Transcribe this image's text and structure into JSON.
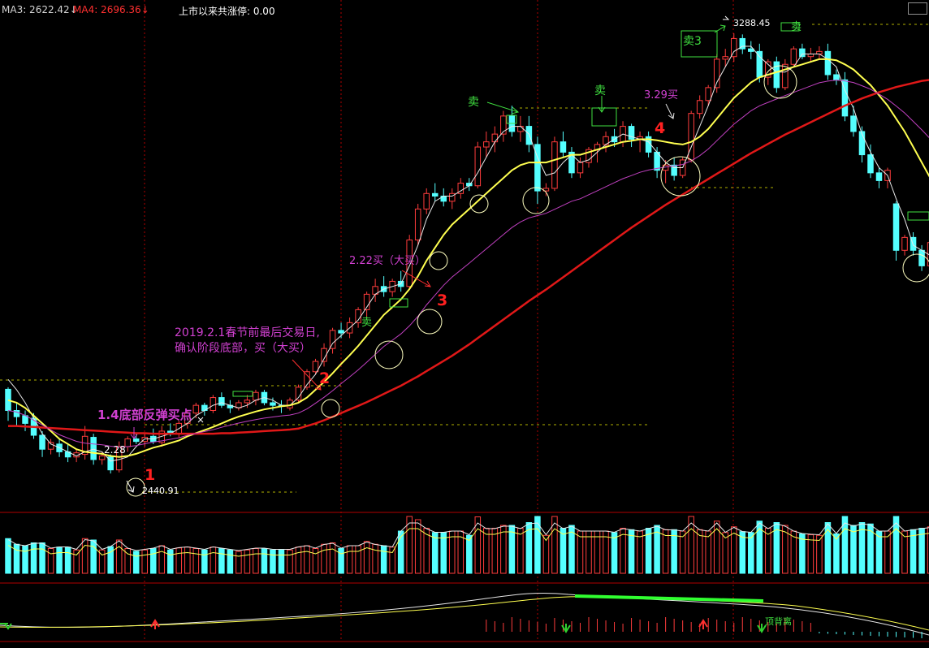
{
  "header": {
    "ma3": {
      "label": "MA3: 2622.42",
      "arrow": "↓",
      "color": "#d4d4d4"
    },
    "ma4": {
      "label": "MA4: 2696.36",
      "arrow": "↓",
      "color": "#ff3030"
    },
    "limit_text": "上市以来共涨停: 0.00"
  },
  "annotations": {
    "bottom_rebound": "1.4底部反弹买点",
    "low_price": "2440.91",
    "price_228": "2.28",
    "spring_line1": "2019.2.1春节前最后交易日,",
    "spring_line2": "确认阶段底部，买（大买）",
    "buy_222": "2.22买（大买）",
    "buy_329": "3.29买",
    "high_price": "3288.45",
    "sell1": "卖",
    "sell2": "卖",
    "sell3": "卖3",
    "sell_small1": "卖",
    "sell_small2": "卖",
    "top_divergence": "顶背离",
    "num1": "1",
    "num2": "2",
    "num3": "3",
    "num4": "4"
  },
  "colors": {
    "up": "#ff3c3c",
    "down": "#54ffff",
    "ma_white": "#e8e8e8",
    "ma_yellow": "#ffff50",
    "ma_magenta": "#c040c0",
    "ma_red": "#e01818",
    "annotation_magenta": "#d040d0",
    "annotation_green": "#40e040",
    "grid": "#b00000"
  },
  "chart_data": {
    "type": "candlestick",
    "price_range": [
      2380,
      3320
    ],
    "candles": [
      [
        2601,
        2605,
        2540,
        2560
      ],
      [
        2560,
        2575,
        2530,
        2548
      ],
      [
        2550,
        2560,
        2520,
        2535
      ],
      [
        2545,
        2555,
        2505,
        2512
      ],
      [
        2512,
        2520,
        2470,
        2485
      ],
      [
        2485,
        2505,
        2475,
        2498
      ],
      [
        2495,
        2505,
        2470,
        2480
      ],
      [
        2480,
        2495,
        2460,
        2470
      ],
      [
        2470,
        2485,
        2460,
        2478
      ],
      [
        2475,
        2530,
        2465,
        2510
      ],
      [
        2508,
        2515,
        2455,
        2465
      ],
      [
        2465,
        2480,
        2455,
        2472
      ],
      [
        2470,
        2475,
        2438,
        2445
      ],
      [
        2445,
        2500,
        2440,
        2490
      ],
      [
        2490,
        2510,
        2480,
        2505
      ],
      [
        2505,
        2515,
        2495,
        2500
      ],
      [
        2500,
        2515,
        2490,
        2508
      ],
      [
        2510,
        2525,
        2495,
        2500
      ],
      [
        2498,
        2530,
        2490,
        2520
      ],
      [
        2520,
        2535,
        2510,
        2515
      ],
      [
        2515,
        2540,
        2508,
        2535
      ],
      [
        2535,
        2560,
        2525,
        2555
      ],
      [
        2555,
        2575,
        2545,
        2570
      ],
      [
        2570,
        2575,
        2550,
        2560
      ],
      [
        2560,
        2590,
        2555,
        2585
      ],
      [
        2585,
        2595,
        2565,
        2570
      ],
      [
        2570,
        2580,
        2555,
        2565
      ],
      [
        2565,
        2580,
        2560,
        2575
      ],
      [
        2575,
        2590,
        2565,
        2580
      ],
      [
        2580,
        2600,
        2570,
        2595
      ],
      [
        2595,
        2600,
        2570,
        2575
      ],
      [
        2575,
        2585,
        2560,
        2570
      ],
      [
        2570,
        2580,
        2555,
        2568
      ],
      [
        2565,
        2585,
        2560,
        2580
      ],
      [
        2580,
        2610,
        2575,
        2605
      ],
      [
        2605,
        2640,
        2600,
        2635
      ],
      [
        2635,
        2660,
        2630,
        2655
      ],
      [
        2655,
        2690,
        2645,
        2680
      ],
      [
        2680,
        2720,
        2670,
        2715
      ],
      [
        2715,
        2730,
        2700,
        2710
      ],
      [
        2710,
        2740,
        2700,
        2730
      ],
      [
        2730,
        2760,
        2720,
        2755
      ],
      [
        2755,
        2790,
        2735,
        2785
      ],
      [
        2785,
        2815,
        2770,
        2800
      ],
      [
        2800,
        2820,
        2780,
        2790
      ],
      [
        2790,
        2815,
        2780,
        2810
      ],
      [
        2810,
        2830,
        2790,
        2800
      ],
      [
        2800,
        2900,
        2795,
        2890
      ],
      [
        2890,
        2960,
        2880,
        2950
      ],
      [
        2950,
        2990,
        2940,
        2980
      ],
      [
        2980,
        3000,
        2965,
        2975
      ],
      [
        2975,
        2990,
        2955,
        2965
      ],
      [
        2965,
        2990,
        2950,
        2980
      ],
      [
        2980,
        3010,
        2970,
        3000
      ],
      [
        3000,
        3010,
        2985,
        2995
      ],
      [
        2995,
        3080,
        2990,
        3070
      ],
      [
        3070,
        3100,
        3050,
        3080
      ],
      [
        3080,
        3110,
        3060,
        3095
      ],
      [
        3095,
        3140,
        3080,
        3130
      ],
      [
        3130,
        3150,
        3090,
        3100
      ],
      [
        3100,
        3130,
        3080,
        3110
      ],
      [
        3110,
        3130,
        3060,
        3075
      ],
      [
        3075,
        3090,
        2960,
        2985
      ],
      [
        2985,
        3000,
        2975,
        2990
      ],
      [
        2990,
        3090,
        2985,
        3080
      ],
      [
        3080,
        3100,
        3050,
        3060
      ],
      [
        3060,
        3070,
        3010,
        3020
      ],
      [
        3020,
        3050,
        3010,
        3040
      ],
      [
        3040,
        3070,
        3030,
        3065
      ],
      [
        3065,
        3080,
        3040,
        3075
      ],
      [
        3075,
        3100,
        3060,
        3090
      ],
      [
        3090,
        3105,
        3070,
        3080
      ],
      [
        3080,
        3120,
        3070,
        3110
      ],
      [
        3110,
        3115,
        3070,
        3085
      ],
      [
        3085,
        3100,
        3060,
        3090
      ],
      [
        3090,
        3100,
        3050,
        3060
      ],
      [
        3060,
        3070,
        3010,
        3025
      ],
      [
        3025,
        3045,
        3000,
        3035
      ],
      [
        3035,
        3050,
        3005,
        3015
      ],
      [
        3015,
        3050,
        3010,
        3045
      ],
      [
        3045,
        3140,
        3040,
        3135
      ],
      [
        3135,
        3170,
        3125,
        3160
      ],
      [
        3160,
        3190,
        3150,
        3185
      ],
      [
        3185,
        3250,
        3175,
        3240
      ],
      [
        3240,
        3260,
        3225,
        3245
      ],
      [
        3245,
        3290,
        3235,
        3280
      ],
      [
        3280,
        3288,
        3250,
        3260
      ],
      [
        3260,
        3275,
        3240,
        3255
      ],
      [
        3255,
        3270,
        3195,
        3205
      ],
      [
        3205,
        3240,
        3190,
        3235
      ],
      [
        3235,
        3245,
        3175,
        3185
      ],
      [
        3185,
        3240,
        3180,
        3230
      ],
      [
        3230,
        3265,
        3225,
        3260
      ],
      [
        3260,
        3270,
        3240,
        3245
      ],
      [
        3245,
        3262,
        3235,
        3250
      ],
      [
        3250,
        3265,
        3240,
        3255
      ],
      [
        3255,
        3270,
        3200,
        3210
      ],
      [
        3210,
        3220,
        3190,
        3200
      ],
      [
        3200,
        3215,
        3120,
        3130
      ],
      [
        3130,
        3150,
        3090,
        3100
      ],
      [
        3100,
        3110,
        3040,
        3055
      ],
      [
        3055,
        3075,
        3010,
        3020
      ],
      [
        3020,
        3030,
        2990,
        3005
      ],
      [
        3005,
        3030,
        2990,
        3025
      ],
      [
        2960,
        2965,
        2850,
        2870
      ],
      [
        2870,
        2900,
        2860,
        2895
      ],
      [
        2895,
        2905,
        2860,
        2870
      ],
      [
        2870,
        2880,
        2830,
        2840
      ],
      [
        2840,
        2890,
        2835,
        2885
      ]
    ],
    "series": [
      {
        "name": "MA3",
        "values": [
          2620,
          2600,
          2575,
          2545,
          2515,
          2495,
          2488,
          2480,
          2472,
          2480,
          2485,
          2480,
          2462,
          2465,
          2470,
          2490,
          2505,
          2505,
          2510,
          2515,
          2525,
          2535,
          2550,
          2560,
          2570,
          2575,
          2570,
          2565,
          2570,
          2580,
          2585,
          2580,
          2570,
          2570,
          2585,
          2610,
          2630,
          2660,
          2690,
          2705,
          2720,
          2735,
          2760,
          2785,
          2795,
          2800,
          2805,
          2840,
          2880,
          2930,
          2965,
          2975,
          2975,
          2985,
          2995,
          3020,
          3050,
          3080,
          3100,
          3110,
          3110,
          3095,
          3050,
          3015,
          3020,
          3040,
          3055,
          3040,
          3045,
          3060,
          3075,
          3085,
          3095,
          3090,
          3085,
          3080,
          3060,
          3040,
          3030,
          3030,
          3070,
          3110,
          3150,
          3195,
          3225,
          3255,
          3265,
          3265,
          3245,
          3230,
          3215,
          3215,
          3225,
          3250,
          3250,
          3250,
          3240,
          3225,
          3180,
          3145,
          3095,
          3060,
          3030,
          3015,
          2970,
          2930,
          2880,
          2870,
          2860
        ]
      },
      {
        "name": "MA2",
        "values": [
          2580,
          2575,
          2565,
          2550,
          2535,
          2520,
          2505,
          2495,
          2485,
          2480,
          2478,
          2476,
          2472,
          2470,
          2472,
          2476,
          2482,
          2488,
          2492,
          2497,
          2502,
          2510,
          2516,
          2522,
          2528,
          2535,
          2542,
          2548,
          2553,
          2558,
          2562,
          2565,
          2568,
          2570,
          2575,
          2585,
          2600,
          2615,
          2632,
          2650,
          2667,
          2685,
          2705,
          2725,
          2745,
          2760,
          2775,
          2795,
          2820,
          2850,
          2875,
          2900,
          2920,
          2935,
          2950,
          2965,
          2980,
          2995,
          3010,
          3025,
          3035,
          3040,
          3040,
          3040,
          3045,
          3050,
          3055,
          3055,
          3060,
          3065,
          3070,
          3075,
          3080,
          3082,
          3085,
          3085,
          3083,
          3080,
          3077,
          3075,
          3080,
          3090,
          3105,
          3125,
          3145,
          3165,
          3180,
          3195,
          3205,
          3210,
          3215,
          3220,
          3225,
          3230,
          3235,
          3240,
          3240,
          3238,
          3230,
          3220,
          3205,
          3190,
          3170,
          3150,
          3125,
          3100,
          3070,
          3040,
          3010
        ]
      },
      {
        "name": "MA4",
        "values": [
          2530,
          2530,
          2529,
          2528,
          2527,
          2526,
          2525,
          2524,
          2523,
          2522,
          2521,
          2520,
          2519,
          2518,
          2517,
          2516,
          2516,
          2515,
          2515,
          2515,
          2515,
          2515,
          2515,
          2515,
          2515,
          2516,
          2516,
          2517,
          2518,
          2519,
          2520,
          2521,
          2522,
          2523,
          2525,
          2530,
          2535,
          2541,
          2548,
          2555,
          2562,
          2569,
          2576,
          2584,
          2592,
          2600,
          2608,
          2617,
          2626,
          2636,
          2646,
          2656,
          2666,
          2677,
          2688,
          2700,
          2712,
          2724,
          2736,
          2748,
          2760,
          2772,
          2783,
          2794,
          2806,
          2818,
          2830,
          2842,
          2854,
          2866,
          2878,
          2890,
          2902,
          2914,
          2925,
          2936,
          2947,
          2958,
          2968,
          2978,
          2988,
          2998,
          3008,
          3018,
          3028,
          3038,
          3048,
          3058,
          3067,
          3076,
          3085,
          3094,
          3102,
          3110,
          3118,
          3126,
          3134,
          3142,
          3150,
          3157,
          3164,
          3170,
          3176,
          3181,
          3186,
          3190,
          3194,
          3198,
          3200
        ]
      }
    ]
  }
}
